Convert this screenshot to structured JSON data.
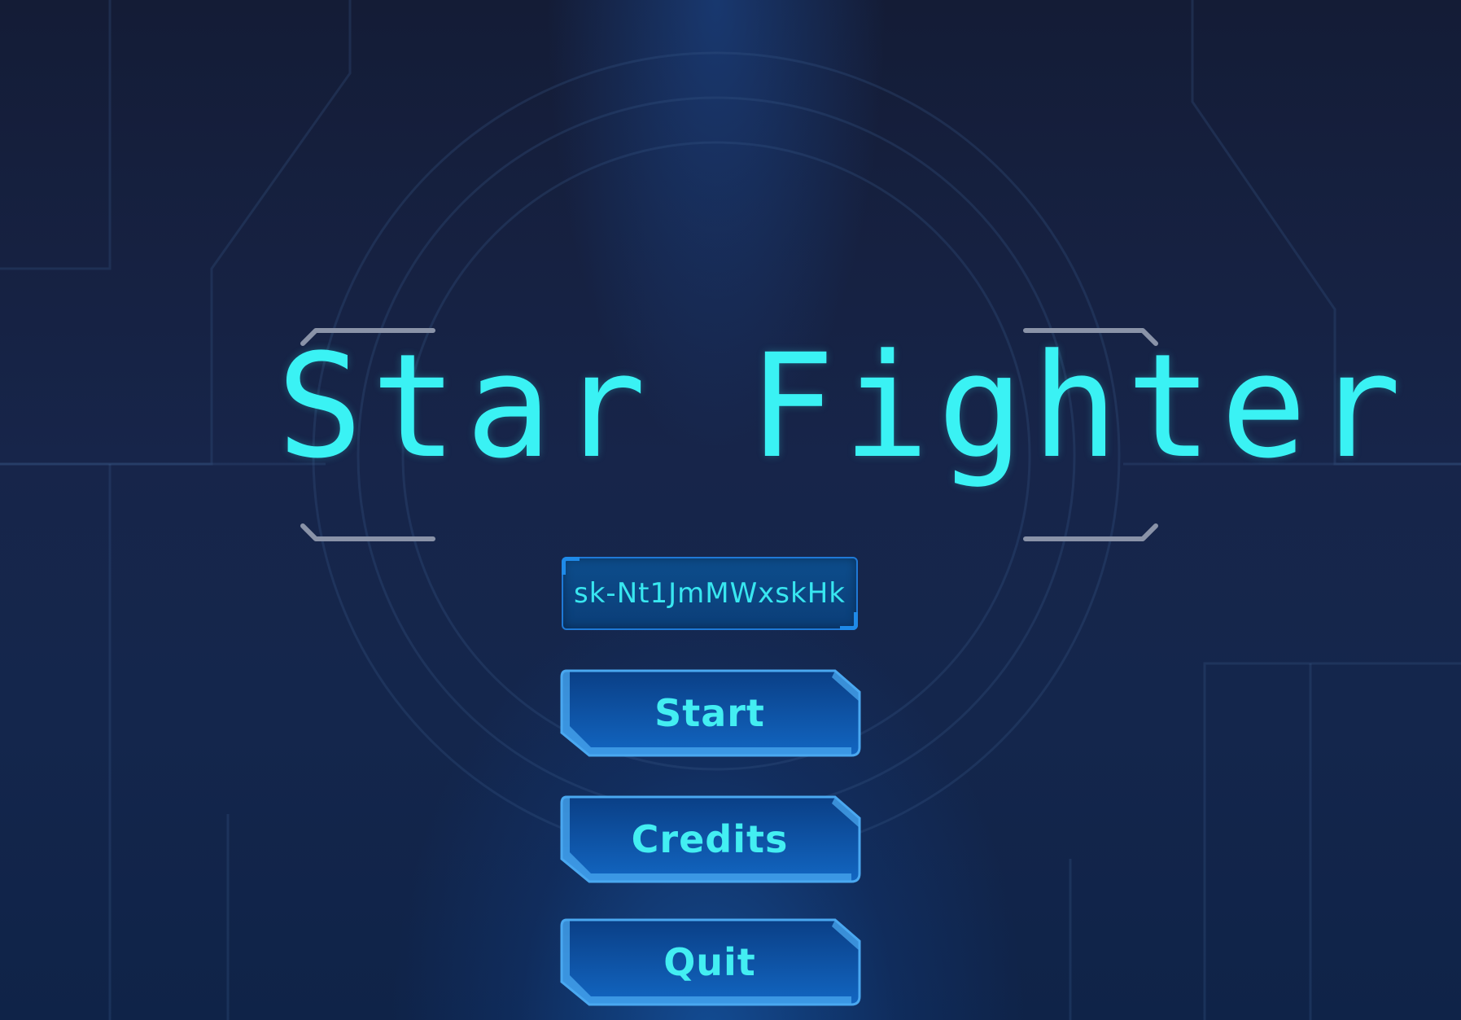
{
  "game": {
    "title": "Star Fighter",
    "api_key_field": {
      "value": "sk-Nt1JmMWxskHk"
    },
    "menu": {
      "start_label": "Start",
      "credits_label": "Credits",
      "quit_label": "Quit"
    }
  },
  "colors": {
    "title": "#3af2f4",
    "button_fill": "#0d56a8",
    "button_border": "#4aa8f0",
    "background": "#121a33"
  }
}
